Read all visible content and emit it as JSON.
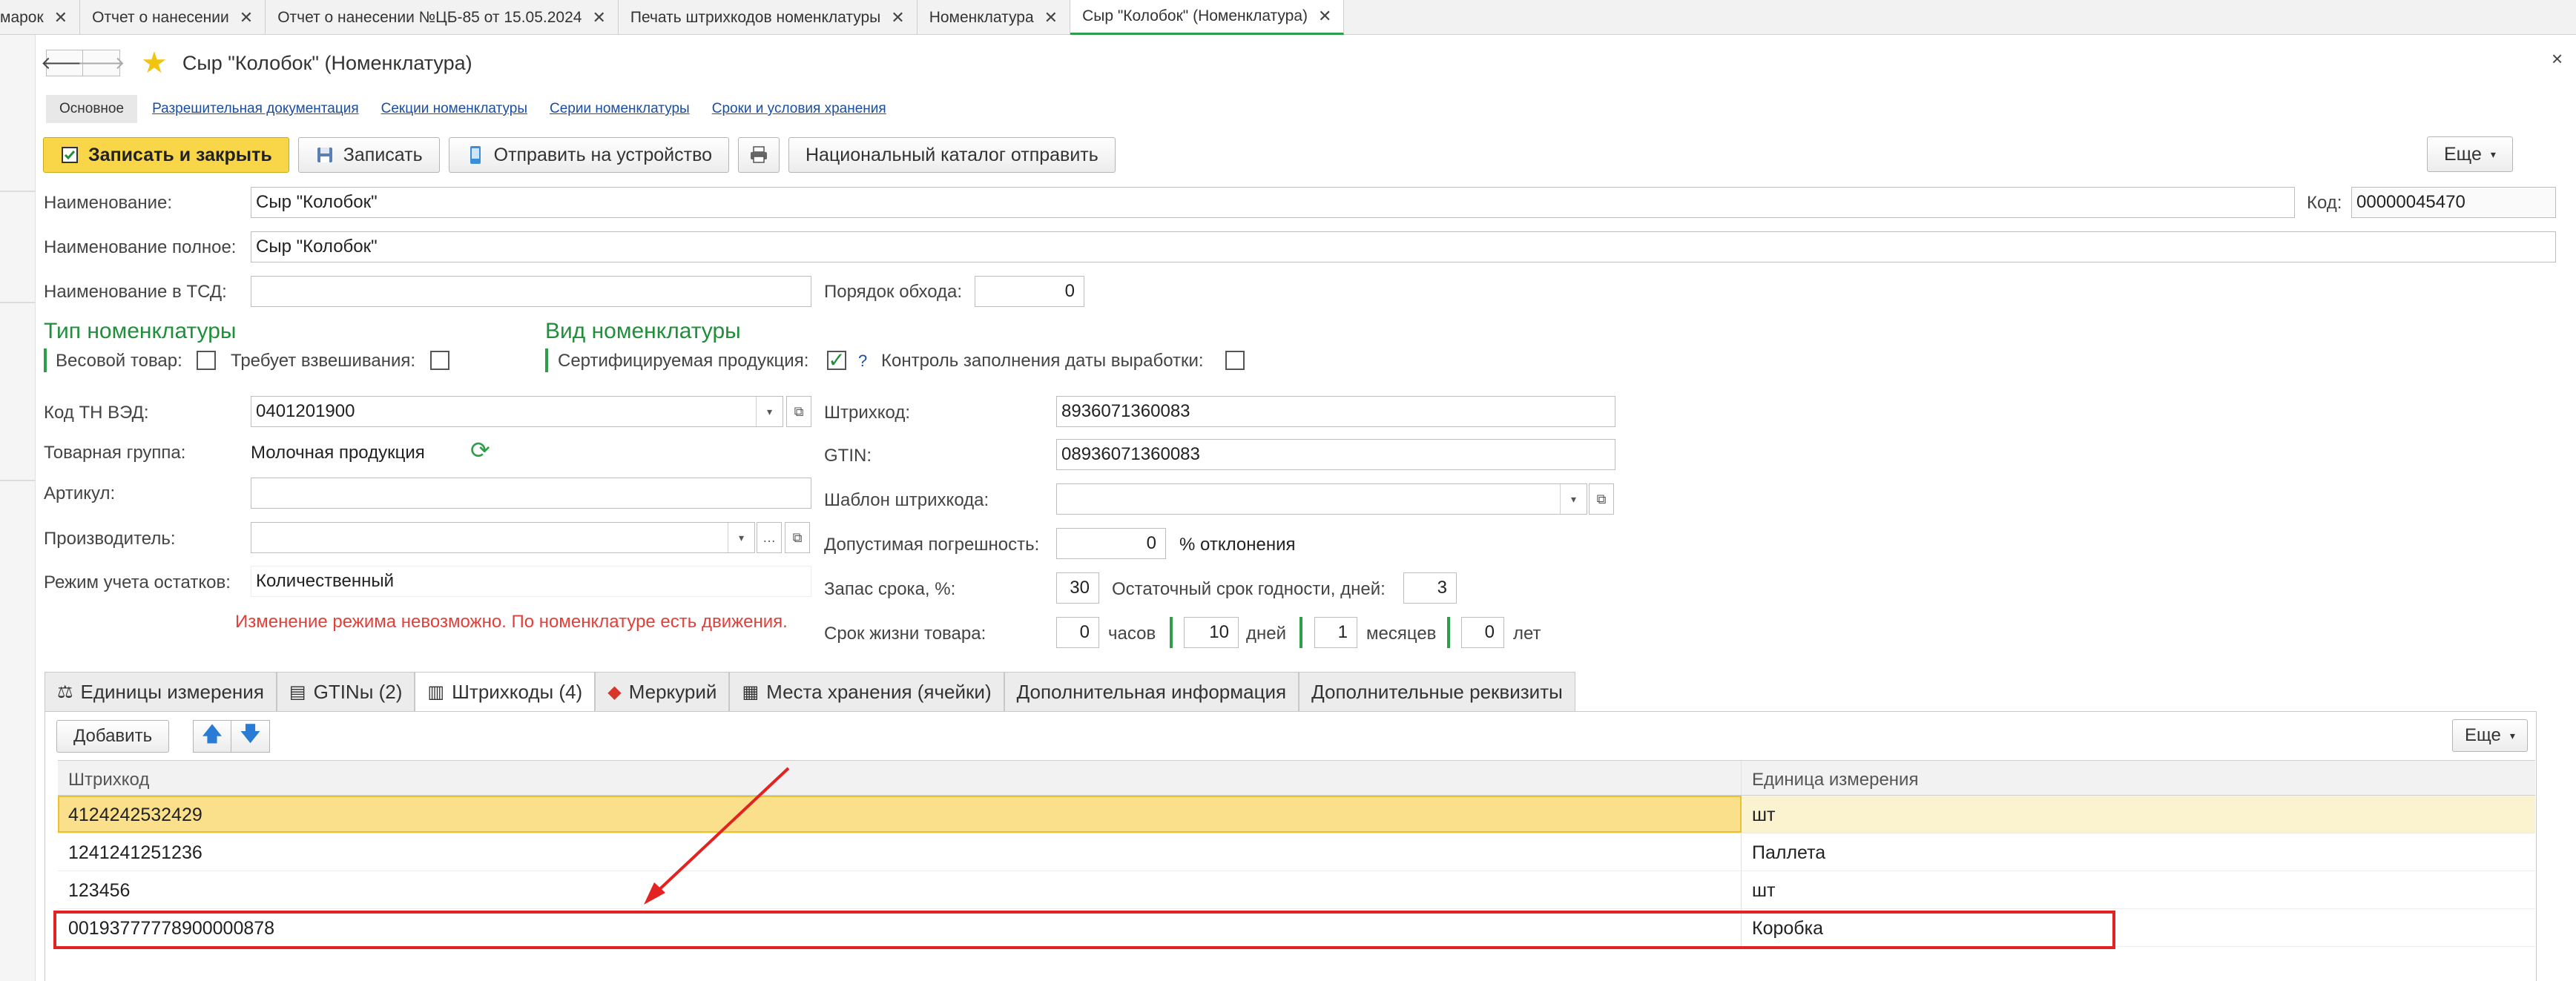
{
  "tabs": [
    {
      "label": "марок",
      "active": false
    },
    {
      "label": "Отчет о нанесении",
      "active": false
    },
    {
      "label": "Отчет о нанесении №ЦБ-85 от 15.05.2024",
      "active": false
    },
    {
      "label": "Печать штрихкодов номенклатуры",
      "active": false
    },
    {
      "label": "Номенклатура",
      "active": false
    },
    {
      "label": "Сыр \"Колобок\" (Номенклатура)",
      "active": true
    }
  ],
  "tab_close": "✕",
  "header": {
    "title": "Сыр \"Колобок\" (Номенклатура)",
    "back": "🡐",
    "forward": "🡒",
    "close": "×"
  },
  "subtabs": [
    "Основное",
    "Разрешительная документация",
    "Секции номенклатуры",
    "Серии номенклатуры",
    "Сроки и условия хранения"
  ],
  "toolbar": {
    "save_close": "Записать и закрыть",
    "save": "Записать",
    "send_device": "Отправить на устройство",
    "national_catalog": "Национальный каталог отправить",
    "more": "Еще"
  },
  "form": {
    "name_label": "Наименование:",
    "name_value": "Сыр \"Колобок\"",
    "code_label": "Код:",
    "code_value": "00000045470",
    "fullname_label": "Наименование полное:",
    "fullname_value": "Сыр \"Колобок\"",
    "tsd_label": "Наименование в ТСД:",
    "tsd_value": "",
    "order_label": "Порядок обхода:",
    "order_value": "0",
    "type_section": "Тип номенклатуры",
    "weight_label": "Весовой товар:",
    "weigh_req_label": "Требует взвешивания:",
    "kind_section": "Вид номенклатуры",
    "cert_label": "Сертифицируемая продукция:",
    "cert_help": "?",
    "date_ctrl_label": "Контроль заполнения даты выработки:",
    "tnved_label": "Код ТН ВЭД:",
    "tnved_value": "0401201900",
    "group_label": "Товарная группа:",
    "group_value": "Молочная продукция",
    "article_label": "Артикул:",
    "article_value": "",
    "producer_label": "Производитель:",
    "producer_value": "",
    "stock_mode_label": "Режим учета остатков:",
    "stock_mode_value": "Количественный",
    "warning": "Изменение режима невозможно. По номенклатуре есть движения.",
    "barcode_label": "Штрихкод:",
    "barcode_value": "8936071360083",
    "gtin_label": "GTIN:",
    "gtin_value": "08936071360083",
    "template_label": "Шаблон штрихкода:",
    "template_value": "",
    "tolerance_label": "Допустимая погрешность:",
    "tolerance_value": "0",
    "tolerance_unit": "% отклонения",
    "reserve_label": "Запас срока, %:",
    "reserve_value": "30",
    "residual_label": "Остаточный срок годности, дней:",
    "residual_value": "3",
    "life_label": "Срок жизни товара:",
    "life_hours": "0",
    "hours_unit": "часов",
    "life_days": "10",
    "days_unit": "дней",
    "life_months": "1",
    "months_unit": "месяцев",
    "life_years": "0",
    "years_unit": "лет"
  },
  "bottom_tabs": [
    "Единицы измерения",
    "GTINы (2)",
    "Штрихкоды (4)",
    "Меркурий",
    "Места хранения (ячейки)",
    "Дополнительная информация",
    "Дополнительные реквизиты"
  ],
  "panel": {
    "add": "Добавить",
    "up": "🡅",
    "down": "🡇",
    "more": "Еще"
  },
  "table": {
    "columns": [
      "Штрихкод",
      "Единица измерения"
    ],
    "rows": [
      [
        "4124242532429",
        "шт"
      ],
      [
        "1241241251236",
        "Паллета"
      ],
      [
        "123456",
        "шт"
      ],
      [
        "00193777778900000878",
        "Коробка"
      ]
    ]
  }
}
